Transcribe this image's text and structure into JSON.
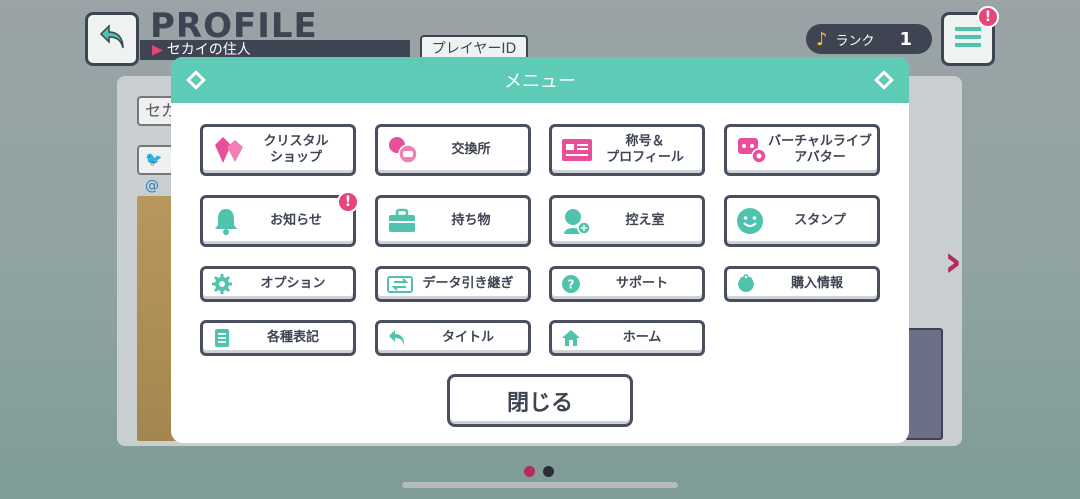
{
  "background": {
    "title": "PROFILE",
    "subtitle": "セカイの住人",
    "player_id_label": "プレイヤーID",
    "rank_label": "ランク",
    "rank_value": "1",
    "name_partial": "セカ",
    "twitter_partial": "@",
    "menu_alert": "!"
  },
  "dialog": {
    "title": "メニュー",
    "buttons": {
      "crystal_shop": "クリスタル\nショップ",
      "exchange": "交換所",
      "title_profile": "称号＆\nプロフィール",
      "virtual_live_avatar": "バーチャルライブ\nアバター",
      "news": "お知らせ",
      "news_alert": "!",
      "items": "持ち物",
      "waiting_room": "控え室",
      "stamp": "スタンプ",
      "options": "オプション",
      "data_transfer": "データ引き継ぎ",
      "support": "サポート",
      "purchase_info": "購入情報",
      "legal": "各種表記",
      "title_screen": "タイトル",
      "home": "ホーム"
    },
    "close_label": "閉じる"
  },
  "colors": {
    "accent": "#5dcbb5",
    "alert": "#e6457a",
    "icon_pink": "#e84f9a",
    "icon_teal": "#4fc3ad",
    "text_dark": "#3f4453"
  }
}
